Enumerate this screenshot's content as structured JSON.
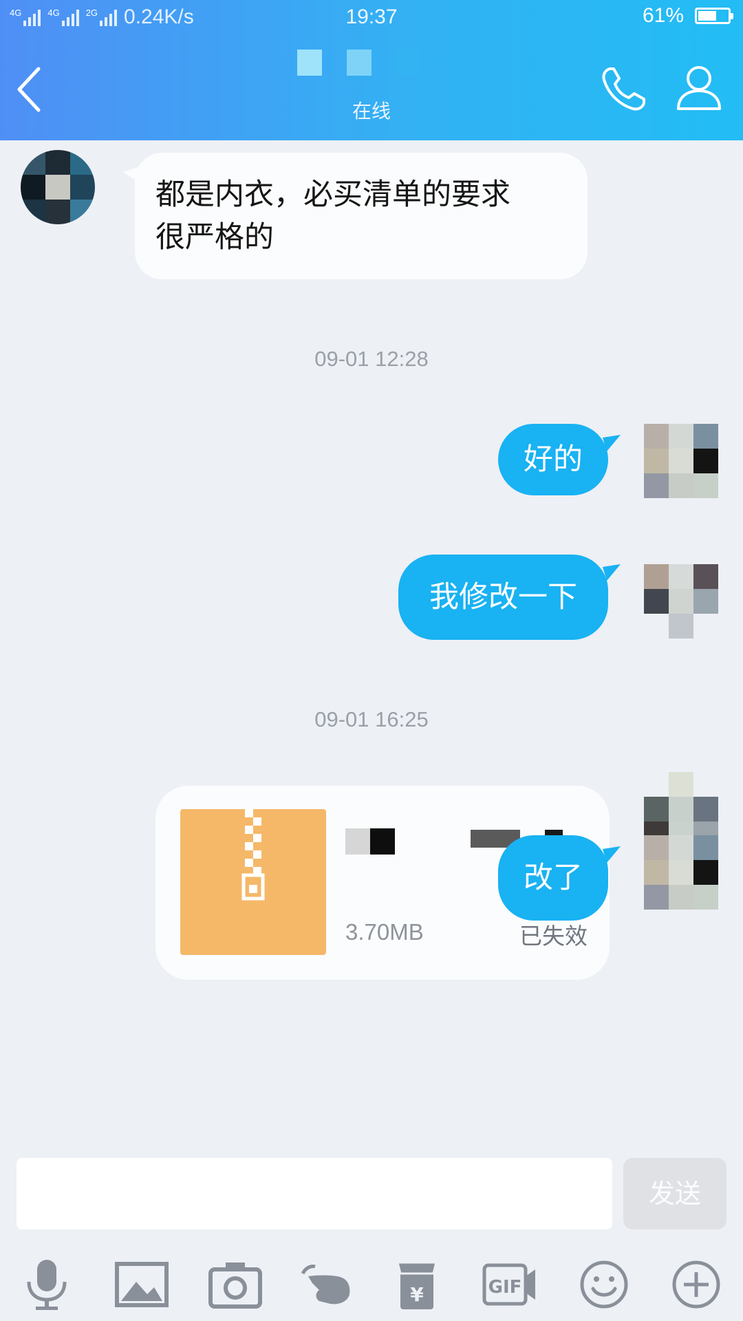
{
  "status_bar": {
    "network": "4G 4G 2G",
    "net_tag_1": "4G",
    "net_tag_2": "4G",
    "net_tag_3": "2G",
    "speed": "0.24K/s",
    "time": "19:37",
    "battery_percent": "61%",
    "battery_level": 0.61
  },
  "header": {
    "contact_status": "在线",
    "back_icon": "chevron-left-icon",
    "call_icon": "phone-icon",
    "profile_icon": "person-icon",
    "accent_color": "#33b1f3"
  },
  "messages": [
    {
      "direction": "in",
      "type": "text",
      "lines": [
        "都是内衣，必买清单的要求",
        "很严格的"
      ]
    },
    {
      "type": "timestamp",
      "text": "09-01 12:28"
    },
    {
      "direction": "out",
      "type": "text",
      "text": "好的"
    },
    {
      "direction": "out",
      "type": "text",
      "text": "我修改一下"
    },
    {
      "type": "timestamp",
      "text": "09-01 16:25"
    },
    {
      "direction": "out",
      "type": "file",
      "icon": "zip-file-icon",
      "size": "3.70MB",
      "status": "已失效"
    },
    {
      "direction": "out",
      "type": "text",
      "text": "改了"
    }
  ],
  "input_bar": {
    "placeholder": "",
    "send_label": "发送"
  },
  "toolbar": {
    "icons": [
      "microphone-icon",
      "image-icon",
      "camera-icon",
      "poke-icon",
      "red-packet-icon",
      "gif-icon",
      "emoji-icon",
      "plus-icon"
    ],
    "gif_label": "GIF",
    "yuan_label": "¥"
  },
  "colors": {
    "outgoing_bubble": "#19b2f2",
    "incoming_bubble": "#fbfcfd",
    "background": "#edf0f5",
    "file_icon": "#f5b869"
  }
}
